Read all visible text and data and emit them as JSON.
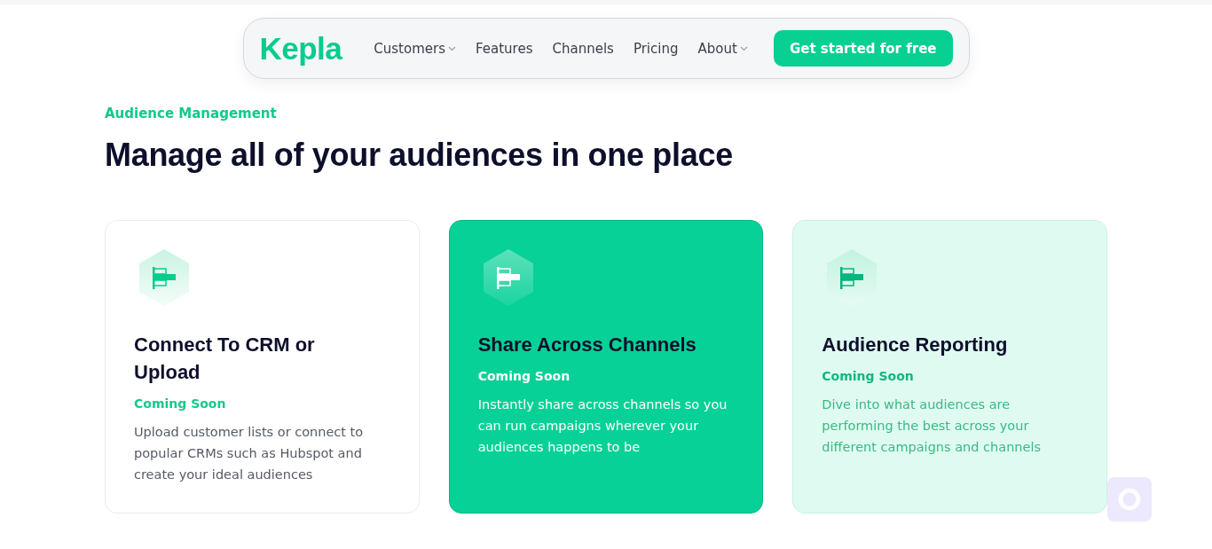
{
  "nav": {
    "logo": "Kepla",
    "items": [
      {
        "label": "Customers",
        "has_menu": true
      },
      {
        "label": "Features",
        "has_menu": false
      },
      {
        "label": "Channels",
        "has_menu": false
      },
      {
        "label": "Pricing",
        "has_menu": false
      },
      {
        "label": "About",
        "has_menu": true
      }
    ],
    "cta": "Get started for free"
  },
  "section": {
    "eyebrow": "Audience Management",
    "heading": "Manage all of your audiences in one place"
  },
  "cards": [
    {
      "kind": "plain",
      "title": "Connect To CRM or Upload",
      "badge": "Coming Soon",
      "text": "Upload customer lists or connect to popular CRMs such as Hubspot and create your ideal audiences"
    },
    {
      "kind": "highlighted",
      "title": "Share Across Channels",
      "badge": "Coming Soon",
      "text": "Instantly share across channels so you can run campaigns wherever your audiences happens to be"
    },
    {
      "kind": "tinted",
      "title": "Audience Reporting",
      "badge": "Coming Soon",
      "text": "Dive into what audiences are performing the best across your different campaigns and channels"
    }
  ]
}
